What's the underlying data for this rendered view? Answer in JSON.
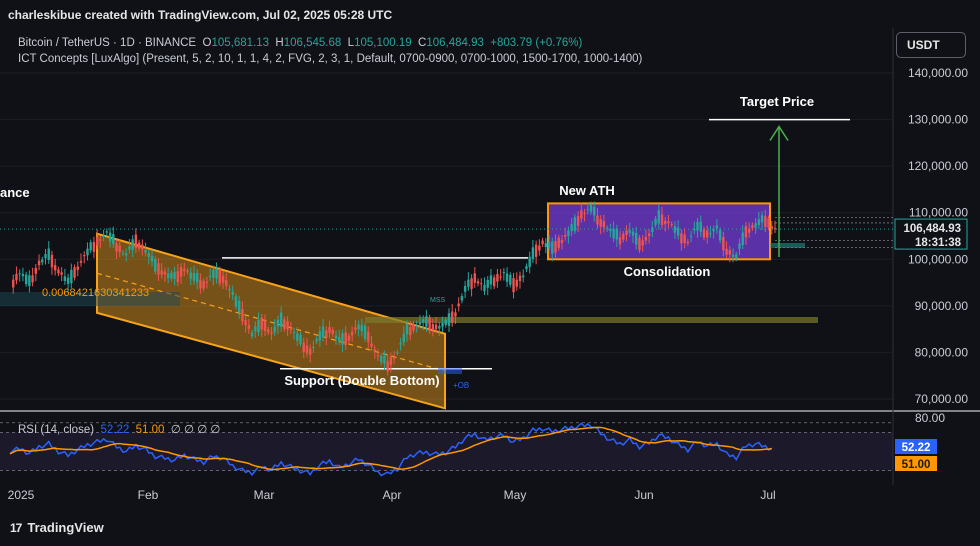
{
  "header": {
    "attribution": "charleskibue created with TradingView.com, Jul 02, 2025 05:28 UTC",
    "symbol_line": "Bitcoin / TetherUS · 1D · BINANCE",
    "ohlc": {
      "o_label": "O",
      "o": "105,681.13",
      "h_label": "H",
      "h": "106,545.68",
      "l_label": "L",
      "l": "105,100.19",
      "c_label": "C",
      "c": "106,484.93",
      "change": "+803.79 (+0.76%)"
    },
    "indicator_line": "ICT Concepts [LuxAlgo] (Present, 5, 2, 10, 1, 1, 4, 2, FVG, 2, 3, 1, Default, 0700-0900, 0700-1000, 1500-1700, 1000-1400)",
    "currency_button": "USDT"
  },
  "rsi": {
    "title": "RSI (14, close)",
    "rsi_value": "52.22",
    "ma_value": "51.00",
    "extra": "∅ ∅ ∅ ∅",
    "level_label": "80.00",
    "badge_rsi": "52.22",
    "badge_ma": "51.00"
  },
  "footer": {
    "brand": "TradingView",
    "logo": "17"
  },
  "colors": {
    "up": "#26a69a",
    "down": "#ef5350",
    "channel": "#f7a21b",
    "range": "#7b3fe4",
    "rsi": "#2962ff",
    "rsi_ma": "#ff9800",
    "target": "#4caf50"
  },
  "chart_data": {
    "type": "candlestick",
    "price_axis": {
      "ticks": [
        70000,
        80000,
        90000,
        100000,
        110000,
        120000,
        130000,
        140000
      ],
      "tick_labels": [
        "70,000.00",
        "80,000.00",
        "90,000.00",
        "100,000.00",
        "110,000.00",
        "120,000.00",
        "130,000.00",
        "140,000.00"
      ]
    },
    "time_axis": {
      "labels": [
        "2025",
        "Feb",
        "Mar",
        "Apr",
        "May",
        "Jun",
        "Jul"
      ]
    },
    "current_price": {
      "value": 106484.93,
      "label": "106,484.93",
      "countdown": "18:31:38"
    },
    "annotations": {
      "target_price": "Target Price",
      "target_level": 130000,
      "new_ath": "New ATH",
      "consolidation": "Consolidation",
      "support": "Support (Double Bottom)",
      "truncated_left_label": "ance",
      "channel_value_label": "0.0068421630341233",
      "mss_label": "MSS",
      "ob_label": "+OB",
      "range_high": 112000,
      "range_low": 100000,
      "resistance_line": 100300,
      "support_line": 76500
    },
    "candles_close_path": [
      [
        0,
        94000
      ],
      [
        3,
        97000
      ],
      [
        6,
        95000
      ],
      [
        9,
        99000
      ],
      [
        12,
        101000
      ],
      [
        15,
        97500
      ],
      [
        18,
        95000
      ],
      [
        21,
        98500
      ],
      [
        24,
        101500
      ],
      [
        27,
        104000
      ],
      [
        30,
        105500
      ],
      [
        33,
        103000
      ],
      [
        36,
        101000
      ],
      [
        39,
        104000
      ],
      [
        42,
        102000
      ],
      [
        45,
        98500
      ],
      [
        48,
        97000
      ],
      [
        51,
        96000
      ],
      [
        54,
        98000
      ],
      [
        57,
        96000
      ],
      [
        60,
        94500
      ],
      [
        63,
        97000
      ],
      [
        66,
        96000
      ],
      [
        69,
        92500
      ],
      [
        72,
        88000
      ],
      [
        75,
        84000
      ],
      [
        78,
        86500
      ],
      [
        81,
        84000
      ],
      [
        84,
        87000
      ],
      [
        87,
        85000
      ],
      [
        90,
        82500
      ],
      [
        93,
        80000
      ],
      [
        96,
        83500
      ],
      [
        99,
        85000
      ],
      [
        102,
        82500
      ],
      [
        105,
        83500
      ],
      [
        108,
        85500
      ],
      [
        111,
        83500
      ],
      [
        114,
        79000
      ],
      [
        117,
        77500
      ],
      [
        120,
        80000
      ],
      [
        123,
        84500
      ],
      [
        126,
        86000
      ],
      [
        129,
        86500
      ],
      [
        132,
        85500
      ],
      [
        135,
        86000
      ],
      [
        138,
        88500
      ],
      [
        141,
        93500
      ],
      [
        144,
        96000
      ],
      [
        147,
        94000
      ],
      [
        150,
        95500
      ],
      [
        153,
        97000
      ],
      [
        156,
        94500
      ],
      [
        159,
        96500
      ],
      [
        162,
        101000
      ],
      [
        165,
        103500
      ],
      [
        168,
        102500
      ],
      [
        171,
        104000
      ],
      [
        174,
        106500
      ],
      [
        177,
        109500
      ],
      [
        180,
        111000
      ],
      [
        183,
        108000
      ],
      [
        186,
        106000
      ],
      [
        189,
        104500
      ],
      [
        192,
        106000
      ],
      [
        195,
        103500
      ],
      [
        198,
        105000
      ],
      [
        201,
        109000
      ],
      [
        204,
        108000
      ],
      [
        207,
        105500
      ],
      [
        210,
        104000
      ],
      [
        213,
        107000
      ],
      [
        216,
        105500
      ],
      [
        219,
        106500
      ],
      [
        222,
        102000
      ],
      [
        225,
        100500
      ],
      [
        228,
        106000
      ],
      [
        231,
        107500
      ],
      [
        234,
        108500
      ],
      [
        237,
        106500
      ]
    ],
    "rsi_series": [
      [
        0,
        50
      ],
      [
        3,
        53
      ],
      [
        6,
        48
      ],
      [
        9,
        55
      ],
      [
        12,
        58
      ],
      [
        15,
        50
      ],
      [
        18,
        46
      ],
      [
        21,
        52
      ],
      [
        24,
        57
      ],
      [
        27,
        60
      ],
      [
        30,
        63
      ],
      [
        33,
        55
      ],
      [
        36,
        50
      ],
      [
        39,
        56
      ],
      [
        42,
        52
      ],
      [
        45,
        45
      ],
      [
        48,
        43
      ],
      [
        51,
        41
      ],
      [
        54,
        46
      ],
      [
        57,
        42
      ],
      [
        60,
        39
      ],
      [
        63,
        45
      ],
      [
        66,
        43
      ],
      [
        69,
        35
      ],
      [
        72,
        30
      ],
      [
        75,
        28
      ],
      [
        78,
        34
      ],
      [
        81,
        31
      ],
      [
        84,
        38
      ],
      [
        87,
        34
      ],
      [
        90,
        30
      ],
      [
        93,
        27
      ],
      [
        96,
        36
      ],
      [
        99,
        40
      ],
      [
        102,
        33
      ],
      [
        105,
        37
      ],
      [
        108,
        42
      ],
      [
        111,
        36
      ],
      [
        114,
        28
      ],
      [
        117,
        26
      ],
      [
        120,
        32
      ],
      [
        123,
        44
      ],
      [
        126,
        48
      ],
      [
        129,
        49
      ],
      [
        132,
        47
      ],
      [
        135,
        49
      ],
      [
        138,
        55
      ],
      [
        141,
        64
      ],
      [
        144,
        68
      ],
      [
        147,
        62
      ],
      [
        150,
        65
      ],
      [
        153,
        67
      ],
      [
        156,
        60
      ],
      [
        159,
        64
      ],
      [
        162,
        72
      ],
      [
        165,
        74
      ],
      [
        168,
        71
      ],
      [
        171,
        73
      ],
      [
        174,
        75
      ],
      [
        177,
        77
      ],
      [
        180,
        78
      ],
      [
        183,
        69
      ],
      [
        186,
        62
      ],
      [
        189,
        58
      ],
      [
        192,
        62
      ],
      [
        195,
        55
      ],
      [
        198,
        59
      ],
      [
        201,
        67
      ],
      [
        204,
        64
      ],
      [
        207,
        57
      ],
      [
        210,
        52
      ],
      [
        213,
        60
      ],
      [
        216,
        56
      ],
      [
        219,
        58
      ],
      [
        222,
        47
      ],
      [
        225,
        44
      ],
      [
        228,
        56
      ],
      [
        231,
        58
      ],
      [
        234,
        55
      ],
      [
        237,
        52
      ]
    ]
  }
}
